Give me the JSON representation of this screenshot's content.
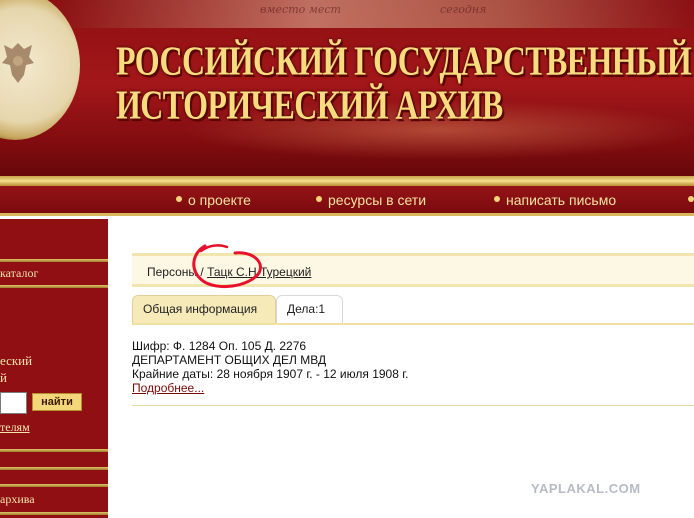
{
  "header": {
    "title_line1": "РОССИЙСКИЙ ГОСУДАРСТВЕННЫЙ",
    "title_line2": "ИСТОРИЧЕСКИЙ АРХИВ",
    "manuscript_text_1": "вместо мест",
    "manuscript_text_2": "сегодня"
  },
  "nav": {
    "items": [
      {
        "label": "о проекте"
      },
      {
        "label": "ресурсы в сети"
      },
      {
        "label": "написать письмо"
      }
    ]
  },
  "sidebar": {
    "catalog_link": "каталог",
    "search_title_1": "еский",
    "search_title_2": "й",
    "search_value": "",
    "search_button": "найти",
    "users_link": "телям",
    "archive_link": "архива"
  },
  "content": {
    "breadcrumb": {
      "root": "Персоны",
      "separator": " / ",
      "current": "Тацк С.Н.Турецкий"
    },
    "tabs": [
      {
        "label": "Общая информация",
        "active": true
      },
      {
        "label": "Дела:1",
        "active": false
      }
    ],
    "record": {
      "cipher": "Шифр: Ф. 1284 Оп. 105 Д. 2276",
      "department": "ДЕПАРТАМЕНТ ОБЩИХ ДЕЛ МВД",
      "dates": "Крайние даты: 28 ноября 1907 г. - 12 июля 1908 г.",
      "more_link": "Подробнее..."
    }
  },
  "watermark": "YAPLAKAL.COM",
  "colors": {
    "header_red": "#8e0f12",
    "gold": "#f6dc7e",
    "tab_active": "#f6eab9",
    "annotation_red": "#e8102a"
  }
}
